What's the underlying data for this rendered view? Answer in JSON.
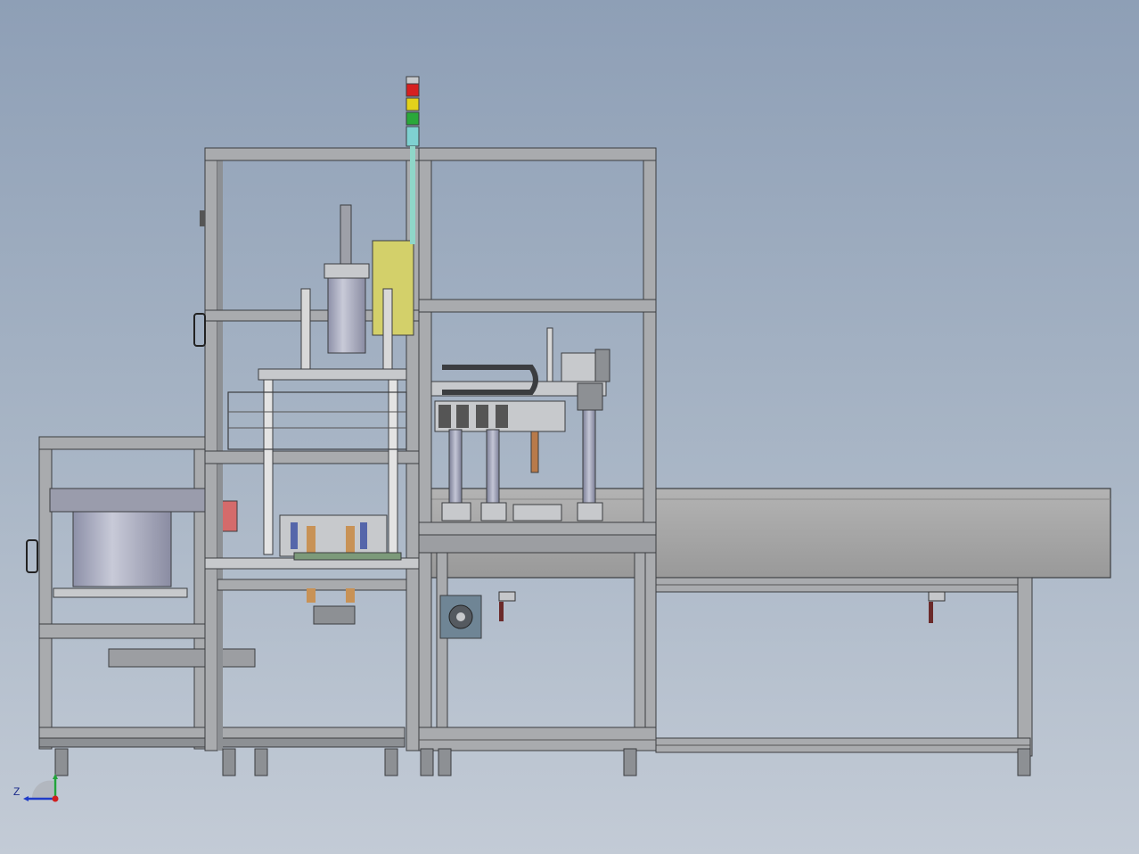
{
  "viewport": {
    "background_top": "#8e9fb6",
    "background_bottom": "#c3cbd6"
  },
  "palette": {
    "frame": "#a9abae",
    "frame_edge": "#3b3d40",
    "steel": "#c7c9cc",
    "shadow": "#555a60",
    "conveyor": "#a0a0a0",
    "cylinder": "#b4b6c8",
    "yellow_box": "#d3d06a",
    "red_block": "#d46b6b",
    "tower_red": "#d62020",
    "tower_yellow": "#e3d21a",
    "tower_green": "#2aa83a",
    "tower_cyan": "#7fd1d1",
    "axis_z": "#1f3cc8",
    "axis_y": "#22a33a",
    "origin": "#d11e1e"
  },
  "triad": {
    "axis_label_z": "Z",
    "icon": "coordinate-triad-icon"
  }
}
